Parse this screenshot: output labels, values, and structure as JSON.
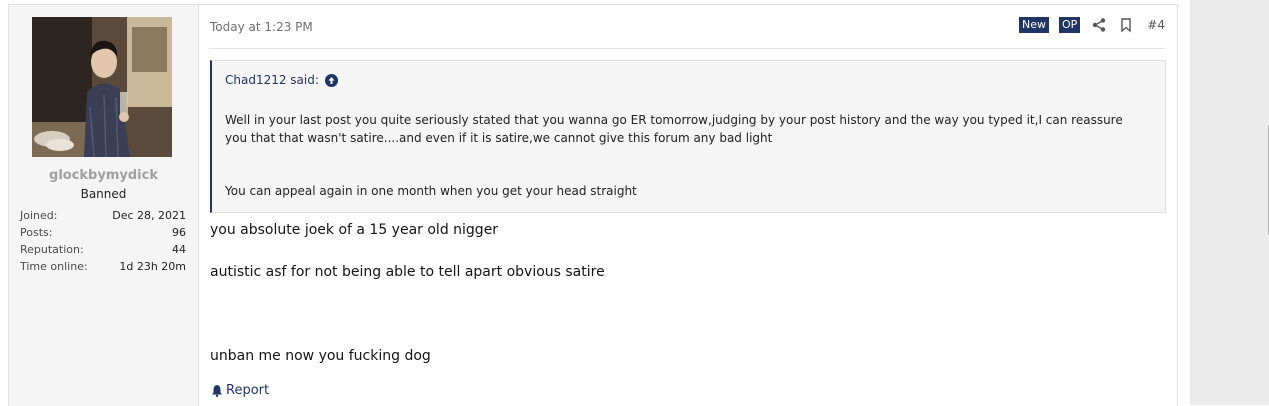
{
  "user": {
    "username": "glockbymydick",
    "title": "Banned",
    "stats": [
      {
        "label": "Joined:",
        "value": "Dec 28, 2021"
      },
      {
        "label": "Posts:",
        "value": "96"
      },
      {
        "label": "Reputation:",
        "value": "44"
      },
      {
        "label": "Time online:",
        "value": "1d 23h 20m"
      }
    ]
  },
  "post": {
    "date": "Today at 1:23 PM",
    "badges": {
      "new": "New",
      "op": "OP"
    },
    "number": "#4",
    "quote": {
      "author": "Chad1212 said:",
      "text": "Well in your last post you quite seriously stated that you wanna go ER tomorrow,judging by your post history and the way you typed it,I can reassure you that that wasn't satire....and even if it is satire,we cannot give this forum any bad light",
      "text2": "You can appeal again in one month when you get your head straight"
    },
    "lines": [
      "you absolute joek of a 15 year old nigger",
      "autistic asf for not being able to tell apart obvious satire",
      "unban me now you fucking dog"
    ],
    "report_label": "Report"
  },
  "colors": {
    "accent": "#1f3467",
    "username": "#a0a0a0",
    "background": "#f5f5f5"
  },
  "icons": [
    "share-icon",
    "bookmark-icon",
    "arrow-up-circle-icon",
    "bell-icon"
  ]
}
